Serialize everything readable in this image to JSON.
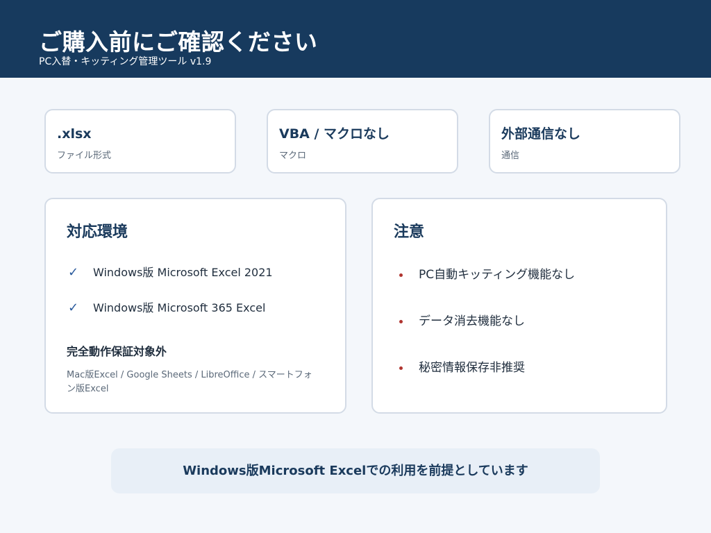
{
  "header": {
    "title": "ご購入前にご確認ください",
    "subtitle": "PC入替・キッティング管理ツール v1.9"
  },
  "specs": [
    {
      "value": ".xlsx",
      "label": "ファイル形式"
    },
    {
      "value": "VBA / マクロなし",
      "label": "マクロ"
    },
    {
      "value": "外部通信なし",
      "label": "通信"
    }
  ],
  "environment": {
    "title": "対応環境",
    "items": [
      "Windows版 Microsoft Excel 2021",
      "Windows版 Microsoft 365 Excel"
    ],
    "unsupported_title": "完全動作保証対象外",
    "unsupported_text": "Mac版Excel / Google Sheets / LibreOffice / スマートフォン版Excel"
  },
  "notes": {
    "title": "注意",
    "items": [
      "PC自動キッティング機能なし",
      "データ消去機能なし",
      "秘密情報保存非推奨"
    ]
  },
  "banner": {
    "text": "Windows版Microsoft Excelでの利用を前提としています"
  },
  "icons": {
    "check": "check-icon",
    "bullet": "bullet-icon"
  },
  "colors": {
    "header_bg": "#173a5e",
    "accent_check": "#2a5a9c",
    "bullet_red": "#b0342f",
    "banner_bg": "#e8eff7"
  }
}
